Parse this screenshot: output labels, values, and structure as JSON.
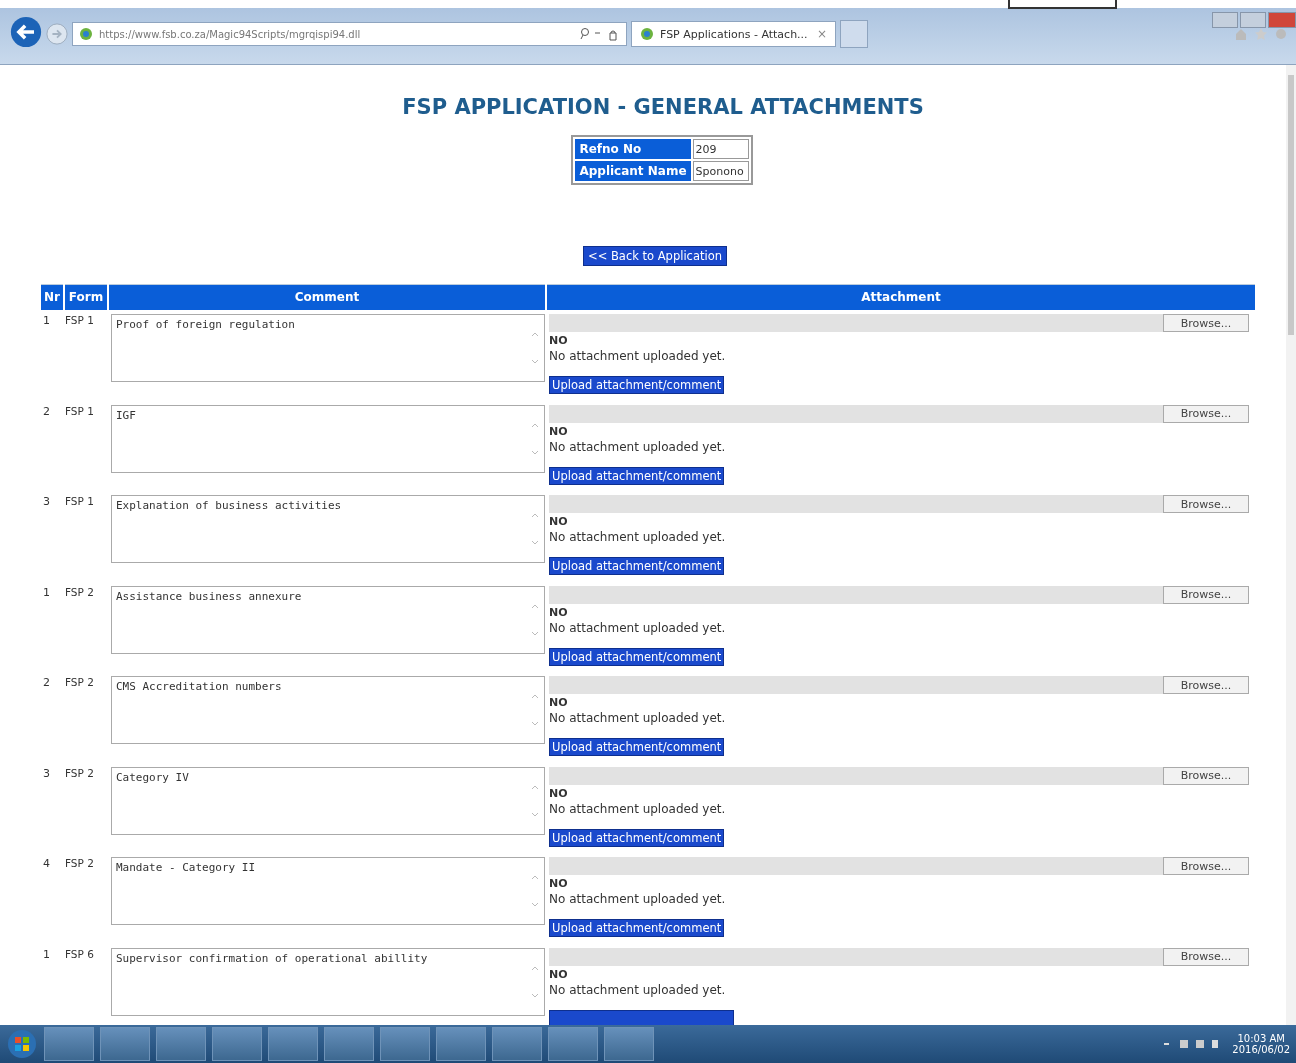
{
  "browser": {
    "url": "https://www.fsb.co.za/Magic94Scripts/mgrqispi94.dll",
    "tab": {
      "title": "FSP Applications - Attach...",
      "close": "×",
      "selected": true
    }
  },
  "page": {
    "title": "FSP APPLICATION - GENERAL ATTACHMENTS",
    "info": [
      {
        "label": "Refno No",
        "value": "209"
      },
      {
        "label": "Applicant Name",
        "value": "Sponono"
      }
    ],
    "back_button": "<< Back to Application",
    "table": {
      "columns": [
        "Nr",
        "Form",
        "Comment",
        "Attachment"
      ],
      "rows": [
        {
          "nr": "1",
          "form": "FSP 1",
          "comment": "Proof of foreign regulation",
          "browse": "Browse...",
          "status": "NO",
          "message": "No attachment uploaded yet.",
          "upload": "Upload attachment/comment"
        },
        {
          "nr": "2",
          "form": "FSP 1",
          "comment": "IGF",
          "browse": "Browse...",
          "status": "NO",
          "message": "No attachment uploaded yet.",
          "upload": "Upload attachment/comment"
        },
        {
          "nr": "3",
          "form": "FSP 1",
          "comment": "Explanation of business activities",
          "browse": "Browse...",
          "status": "NO",
          "message": "No attachment uploaded yet.",
          "upload": "Upload attachment/comment"
        },
        {
          "nr": "1",
          "form": "FSP 2",
          "comment": "Assistance business annexure",
          "browse": "Browse...",
          "status": "NO",
          "message": "No attachment uploaded yet.",
          "upload": "Upload attachment/comment"
        },
        {
          "nr": "2",
          "form": "FSP 2",
          "comment": "CMS Accreditation numbers",
          "browse": "Browse...",
          "status": "NO",
          "message": "No attachment uploaded yet.",
          "upload": "Upload attachment/comment"
        },
        {
          "nr": "3",
          "form": "FSP 2",
          "comment": "Category IV",
          "browse": "Browse...",
          "status": "NO",
          "message": "No attachment uploaded yet.",
          "upload": "Upload attachment/comment"
        },
        {
          "nr": "4",
          "form": "FSP 2",
          "comment": "Mandate - Category II",
          "browse": "Browse...",
          "status": "NO",
          "message": "No attachment uploaded yet.",
          "upload": "Upload attachment/comment"
        },
        {
          "nr": "1",
          "form": "FSP 6",
          "comment": "Supervisor confirmation of operational abillity",
          "browse": "Browse...",
          "status": "NO",
          "message": "No attachment uploaded yet."
        }
      ]
    }
  },
  "taskbar": {
    "time": "10:03 AM",
    "date": "2016/06/02"
  }
}
